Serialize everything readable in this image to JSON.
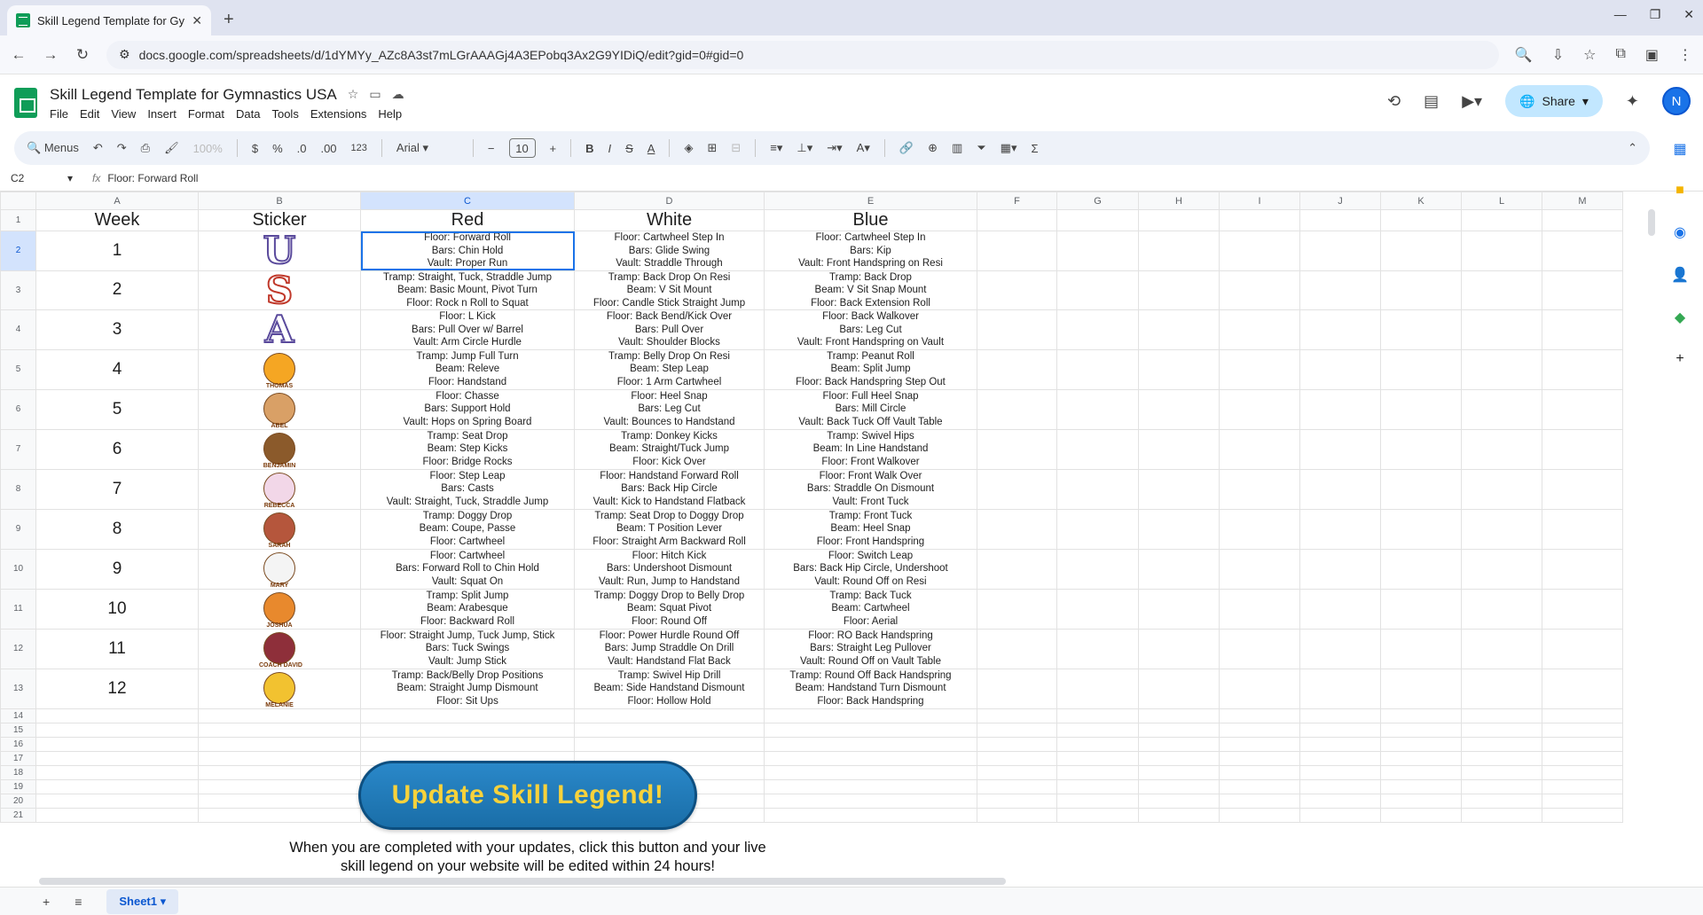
{
  "browser": {
    "tab_title": "Skill Legend Template for Gym",
    "url": "docs.google.com/spreadsheets/d/1dYMYy_AZc8A3st7mLGrAAAGj4A3EPobq3Ax2G9YIDiQ/edit?gid=0#gid=0"
  },
  "doc": {
    "title": "Skill Legend Template for Gymnastics USA",
    "menus": [
      "File",
      "Edit",
      "View",
      "Insert",
      "Format",
      "Data",
      "Tools",
      "Extensions",
      "Help"
    ],
    "share_label": "Share",
    "avatar_initial": "N"
  },
  "toolbar": {
    "menus_label": "Menus",
    "zoom": "100%",
    "currency": "$",
    "percent": "%",
    "dec_dec": ".0",
    "dec_inc": ".00",
    "fmt_123": "123",
    "font": "Arial",
    "font_size": "10"
  },
  "formula_bar": {
    "cell_ref": "C2",
    "content": "Floor: Forward Roll"
  },
  "columns": [
    "A",
    "B",
    "C",
    "D",
    "E",
    "F",
    "G",
    "H",
    "I",
    "J",
    "K",
    "L",
    "M"
  ],
  "rows": [
    "1",
    "2",
    "3",
    "4",
    "5",
    "6",
    "7",
    "8",
    "9",
    "10",
    "11",
    "12",
    "13",
    "14",
    "15",
    "16",
    "17",
    "18",
    "19",
    "20",
    "21"
  ],
  "table": {
    "headers": [
      "Week",
      "Sticker",
      "Red",
      "White",
      "Blue"
    ],
    "weeks": [
      {
        "week": "1",
        "sticker": "U",
        "sticker_color": "#5a4a9c",
        "red": [
          "Floor: Forward Roll",
          "Bars: Chin Hold",
          "Vault: Proper Run"
        ],
        "white": [
          "Floor: Cartwheel Step In",
          "Bars: Glide Swing",
          "Vault: Straddle Through"
        ],
        "blue": [
          "Floor: Cartwheel Step In",
          "Bars: Kip",
          "Vault: Front Handspring on Resi"
        ]
      },
      {
        "week": "2",
        "sticker": "S",
        "sticker_color": "#c0392b",
        "red": [
          "Tramp: Straight, Tuck, Straddle Jump",
          "Beam: Basic Mount, Pivot Turn",
          "Floor: Rock n Roll to Squat"
        ],
        "white": [
          "Tramp: Back Drop On Resi",
          "Beam: V Sit Mount",
          "Floor: Candle Stick Straight Jump"
        ],
        "blue": [
          "Tramp: Back Drop",
          "Beam: V Sit Snap Mount",
          "Floor: Back Extension Roll"
        ]
      },
      {
        "week": "3",
        "sticker": "A",
        "sticker_color": "#5a4a9c",
        "red": [
          "Floor: L Kick",
          "Bars: Pull Over w/ Barrel",
          "Vault: Arm Circle Hurdle"
        ],
        "white": [
          "Floor: Back Bend/Kick Over",
          "Bars: Pull Over",
          "Vault: Shoulder Blocks"
        ],
        "blue": [
          "Floor: Back Walkover",
          "Bars: Leg Cut",
          "Vault: Front Handspring on Vault"
        ]
      },
      {
        "week": "4",
        "sticker": "THOMAS",
        "sticker_color": "#f5a623",
        "red": [
          "Tramp: Jump Full Turn",
          "Beam: Releve",
          "Floor: Handstand"
        ],
        "white": [
          "Tramp: Belly Drop On Resi",
          "Beam: Step Leap",
          "Floor: 1 Arm Cartwheel"
        ],
        "blue": [
          "Tramp: Peanut Roll",
          "Beam: Split Jump",
          "Floor: Back Handspring Step Out"
        ]
      },
      {
        "week": "5",
        "sticker": "ABEL",
        "sticker_color": "#d9a066",
        "red": [
          "Floor: Chasse",
          "Bars: Support Hold",
          "Vault: Hops on Spring Board"
        ],
        "white": [
          "Floor: Heel Snap",
          "Bars: Leg Cut",
          "Vault: Bounces to Handstand"
        ],
        "blue": [
          "Floor: Full Heel Snap",
          "Bars: Mill Circle",
          "Vault: Back Tuck Off Vault Table"
        ]
      },
      {
        "week": "6",
        "sticker": "BENJAMIN",
        "sticker_color": "#8b5a2b",
        "red": [
          "Tramp: Seat Drop",
          "Beam: Step Kicks",
          "Floor: Bridge Rocks"
        ],
        "white": [
          "Tramp: Donkey Kicks",
          "Beam: Straight/Tuck Jump",
          "Floor: Kick Over"
        ],
        "blue": [
          "Tramp: Swivel Hips",
          "Beam: In Line Handstand",
          "Floor: Front Walkover"
        ]
      },
      {
        "week": "7",
        "sticker": "REBECCA",
        "sticker_color": "#f2d7e8",
        "red": [
          "Floor: Step Leap",
          "Bars: Casts",
          "Vault: Straight, Tuck, Straddle Jump"
        ],
        "white": [
          "Floor: Handstand Forward Roll",
          "Bars: Back Hip Circle",
          "Vault: Kick to Handstand Flatback"
        ],
        "blue": [
          "Floor: Front Walk Over",
          "Bars: Straddle On Dismount",
          "Vault: Front Tuck"
        ]
      },
      {
        "week": "8",
        "sticker": "SARAH",
        "sticker_color": "#b5563c",
        "red": [
          "Tramp: Doggy Drop",
          "Beam: Coupe, Passe",
          "Floor: Cartwheel"
        ],
        "white": [
          "Tramp: Seat Drop to Doggy Drop",
          "Beam: T Position Lever",
          "Floor: Straight Arm Backward Roll"
        ],
        "blue": [
          "Tramp: Front Tuck",
          "Beam: Heel Snap",
          "Floor: Front Handspring"
        ]
      },
      {
        "week": "9",
        "sticker": "MARY",
        "sticker_color": "#f4f4f4",
        "red": [
          "Floor: Cartwheel",
          "Bars: Forward Roll to Chin Hold",
          "Vault: Squat On"
        ],
        "white": [
          "Floor: Hitch Kick",
          "Bars: Undershoot Dismount",
          "Vault: Run, Jump to Handstand"
        ],
        "blue": [
          "Floor: Switch Leap",
          "Bars: Back Hip Circle, Undershoot",
          "Vault: Round Off on Resi"
        ]
      },
      {
        "week": "10",
        "sticker": "JOSHUA",
        "sticker_color": "#e8892d",
        "red": [
          "Tramp: Split Jump",
          "Beam: Arabesque",
          "Floor: Backward Roll"
        ],
        "white": [
          "Tramp: Doggy Drop to Belly Drop",
          "Beam: Squat Pivot",
          "Floor: Round Off"
        ],
        "blue": [
          "Tramp: Back Tuck",
          "Beam: Cartwheel",
          "Floor: Aerial"
        ]
      },
      {
        "week": "11",
        "sticker": "COACH DAVID",
        "sticker_color": "#8e2f3a",
        "red": [
          "Floor: Straight Jump, Tuck Jump, Stick",
          "Bars: Tuck Swings",
          "Vault: Jump Stick"
        ],
        "white": [
          "Floor: Power Hurdle Round Off",
          "Bars: Jump Straddle On Drill",
          "Vault: Handstand Flat Back"
        ],
        "blue": [
          "Floor: RO Back Handspring",
          "Bars: Straight Leg Pullover",
          "Vault: Round Off on Vault Table"
        ]
      },
      {
        "week": "12",
        "sticker": "MELANIE",
        "sticker_color": "#f2c230",
        "red": [
          "Tramp: Back/Belly Drop Positions",
          "Beam: Straight Jump Dismount",
          "Floor: Sit Ups"
        ],
        "white": [
          "Tramp: Swivel Hip Drill",
          "Beam: Side Handstand Dismount",
          "Floor: Hollow Hold"
        ],
        "blue": [
          "Tramp: Round Off Back Handspring",
          "Beam: Handstand Turn Dismount",
          "Floor: Back Handspring"
        ]
      }
    ]
  },
  "update_button": {
    "label": "Update Skill Legend!",
    "colors": {
      "fill": "#1f7bbd",
      "text": "#f7d23b"
    }
  },
  "note": "When you are completed with your updates, click this button and your live skill legend on your website will be edited within 24 hours!",
  "sheet_tab": "Sheet1"
}
